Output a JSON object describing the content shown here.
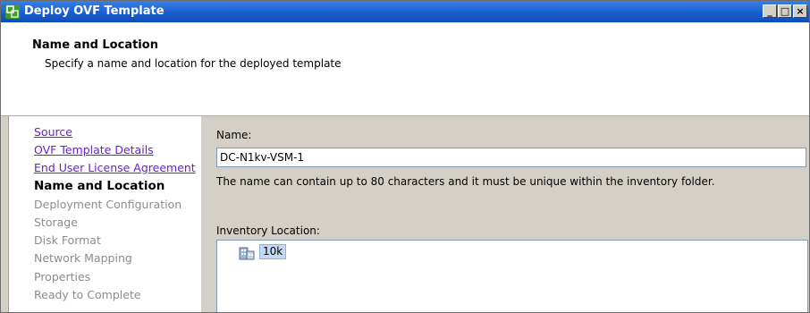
{
  "window": {
    "title": "Deploy OVF Template",
    "controls": {
      "minimize": "_",
      "maximize": "□",
      "close": "×"
    }
  },
  "header": {
    "title": "Name and Location",
    "subtitle": "Specify a name and location for the deployed template"
  },
  "nav": {
    "items": [
      {
        "label": "Source",
        "state": "link"
      },
      {
        "label": "OVF Template Details",
        "state": "link"
      },
      {
        "label": "End User License Agreement",
        "state": "link"
      },
      {
        "label": "Name and Location",
        "state": "current"
      },
      {
        "label": "Deployment Configuration",
        "state": "disabled"
      },
      {
        "label": "Storage",
        "state": "disabled"
      },
      {
        "label": "Disk Format",
        "state": "disabled"
      },
      {
        "label": "Network Mapping",
        "state": "disabled"
      },
      {
        "label": "Properties",
        "state": "disabled"
      },
      {
        "label": "Ready to Complete",
        "state": "disabled"
      }
    ]
  },
  "form": {
    "name_label": "Name:",
    "name_value": "DC-N1kv-VSM-1",
    "hint": "The name can contain up to 80 characters and it must be unique within the inventory folder.",
    "inventory_label": "Inventory Location:",
    "tree": [
      {
        "label": "10k",
        "icon": "datacenter-icon",
        "selected": true
      }
    ]
  },
  "colors": {
    "titlebar": "#1a5fd0",
    "dialog_face": "#d4d0c8",
    "link": "#6a1fd0",
    "disabled_text": "#8c8c8c",
    "selection": "#c4d9f4"
  }
}
